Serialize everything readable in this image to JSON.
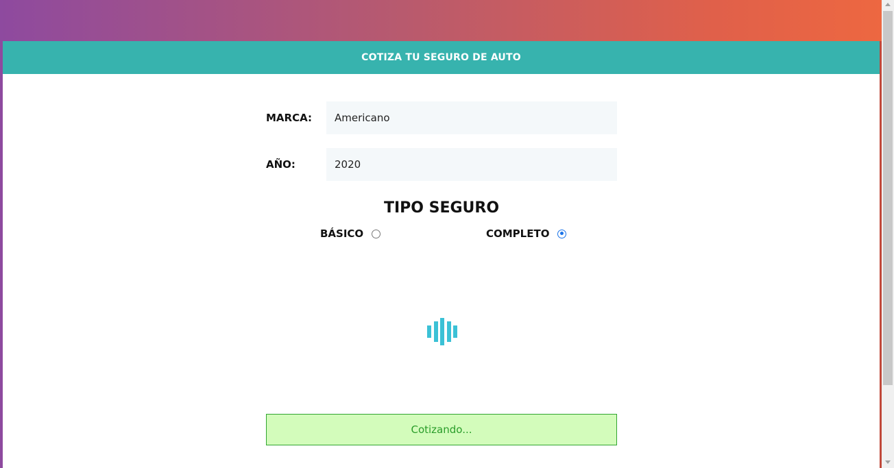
{
  "header": {
    "title": "COTIZA TU SEGURO DE AUTO"
  },
  "form": {
    "marca": {
      "label": "MARCA:",
      "value": "Americano"
    },
    "anio": {
      "label": "AÑO:",
      "value": "2020"
    },
    "tipo_seguro": {
      "title": "TIPO SEGURO",
      "options": [
        {
          "label": "BÁSICO",
          "checked": false
        },
        {
          "label": "COMPLETO",
          "checked": true
        }
      ]
    }
  },
  "status": {
    "message": "Cotizando..."
  },
  "colors": {
    "header": "#37b3ae",
    "spinner": "#3bc1d6",
    "result_bg": "#d3fcbb",
    "result_text": "#2a9d2a",
    "radio_checked": "#1a73e8"
  }
}
